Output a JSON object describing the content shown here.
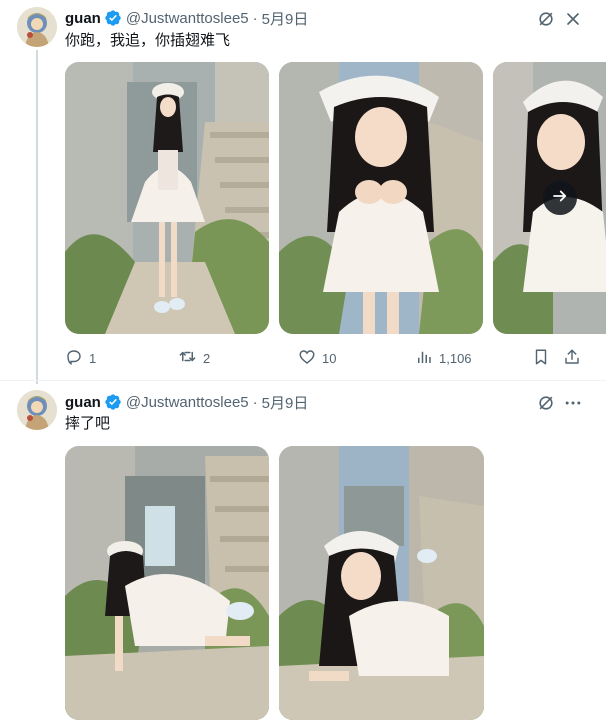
{
  "tweets": [
    {
      "author": {
        "name": "guan",
        "handle": "@Justwanttoslee5",
        "date": "5月9日"
      },
      "text": "你跑，我追，你插翅难飞",
      "media_count_visible": 3,
      "actions": {
        "replies": "1",
        "reposts": "2",
        "likes": "10",
        "views": "1,106"
      }
    },
    {
      "author": {
        "name": "guan",
        "handle": "@Justwanttoslee5",
        "date": "5月9日"
      },
      "text": "摔了吧",
      "media_count_visible": 2
    }
  ],
  "separator": "·",
  "colors": {
    "text_primary": "#0f1419",
    "text_secondary": "#536471",
    "verified_blue": "#1d9bf0",
    "divider": "#eff3f4",
    "thread_line": "#cfd9de"
  },
  "icons": [
    "verified-badge-icon",
    "grok-icon",
    "more-icon",
    "reply-icon",
    "repost-icon",
    "like-icon",
    "views-icon",
    "bookmark-icon",
    "share-icon",
    "arrow-right-icon"
  ]
}
